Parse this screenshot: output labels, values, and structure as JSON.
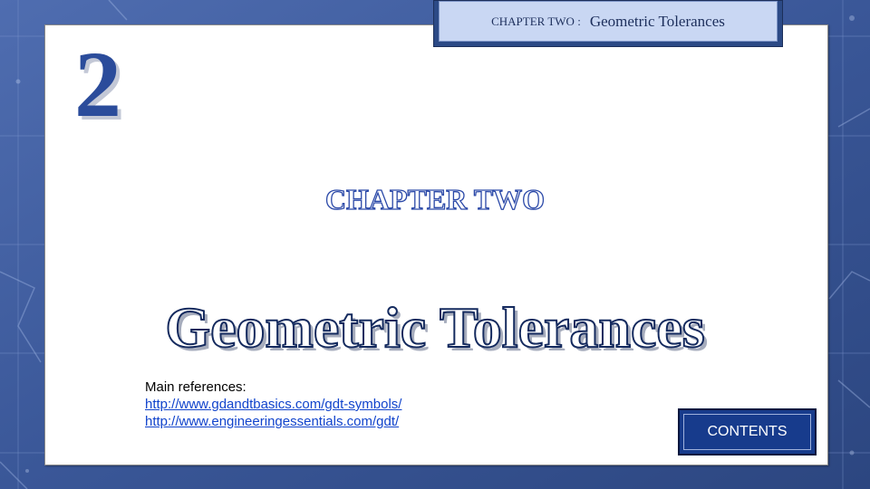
{
  "header": {
    "prefix": "CHAPTER TWO :",
    "subject": "Geometric Tolerances"
  },
  "chapter_number": "2",
  "chapter_heading": "CHAPTER TWO",
  "title": "Geometric Tolerances",
  "references": {
    "label": "Main references:",
    "links": [
      "http://www.gdandtbasics.com/gdt-symbols/",
      "http://www.engineeringessentials.com/gdt/"
    ]
  },
  "contents_button": "CONTENTS",
  "colors": {
    "background": "#3c5a99",
    "accent": "#2b4c9b",
    "button": "#173b8c"
  }
}
